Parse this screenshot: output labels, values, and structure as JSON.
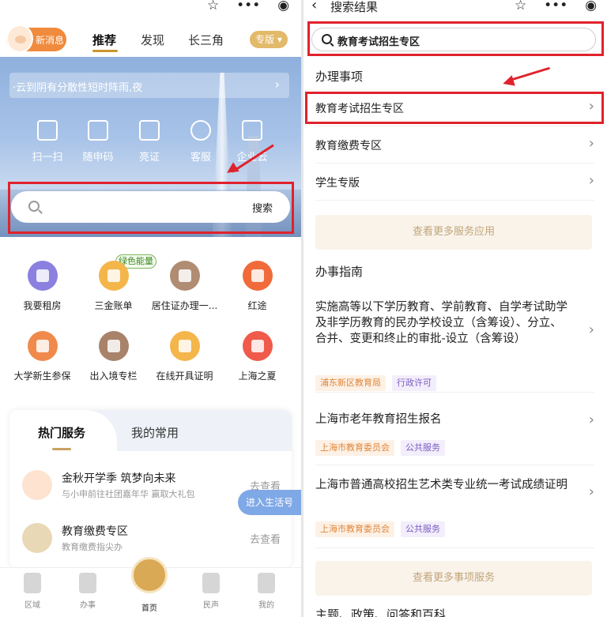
{
  "left": {
    "header": {
      "message_badge": "新消息",
      "tabs": [
        "推荐",
        "发现",
        "长三角"
      ],
      "edition": "专版"
    },
    "caps_icons": [
      "☆",
      "•••",
      "◉"
    ],
    "weather": {
      "text": "·云到阴有分散性短时阵雨,夜",
      "arrow": "›"
    },
    "quick_actions": [
      {
        "label": "扫一扫",
        "icon": "scan-icon"
      },
      {
        "label": "随申码",
        "icon": "qrcode-icon"
      },
      {
        "label": "亮证",
        "icon": "card-icon"
      },
      {
        "label": "客服",
        "icon": "headset-icon"
      },
      {
        "label": "企业云",
        "icon": "building-icon"
      }
    ],
    "search": {
      "button": "搜索"
    },
    "green_tag": "绿色能量",
    "services": [
      {
        "label": "我要租房",
        "color": "#8b7fe0",
        "icon": "house-icon"
      },
      {
        "label": "三金账单",
        "color": "#f4b54a",
        "icon": "yuan-icon"
      },
      {
        "label": "居住证办理一...",
        "color": "#b08c73",
        "icon": "id-card-icon"
      },
      {
        "label": "红途",
        "color": "#f06a3a",
        "icon": "star-icon"
      },
      {
        "label": "大学新生参保",
        "color": "#f08a4c",
        "icon": "edit-icon"
      },
      {
        "label": "出入境专栏",
        "color": "#a9826a",
        "icon": "plane-icon"
      },
      {
        "label": "在线开具证明",
        "color": "#f4b54a",
        "icon": "document-icon"
      },
      {
        "label": "上海之夏",
        "color": "#f05a4a",
        "icon": "cart-icon"
      }
    ],
    "hot_card": {
      "tab_active": "热门服务",
      "tab_other": "我的常用",
      "rows": [
        {
          "title": "金秋开学季 筑梦向未来",
          "subtitle": "与小申前往社团嘉年华 赢取大礼包",
          "action": "去查看",
          "avatar_color": "#fde3d0"
        },
        {
          "title": "教育缴费专区",
          "subtitle": "教育缴费指尖办",
          "action": "去查看",
          "avatar_color": "#e9d8b5"
        }
      ]
    },
    "float_button": "进入生活号",
    "nav": [
      "区域",
      "办事",
      "首页",
      "民声",
      "我的"
    ]
  },
  "right": {
    "top": {
      "back": "‹",
      "title": "搜索结果"
    },
    "caps_icons": [
      "☆",
      "•••",
      "◉"
    ],
    "search_value": "教育考试招生专区",
    "section1": "办理事项",
    "items": [
      "教育考试招生专区",
      "教育缴费专区",
      "学生专版"
    ],
    "more_services": "查看更多服务应用",
    "section2": "办事指南",
    "guides": [
      {
        "title": "实施高等以下学历教育、学前教育、自学考试助学及非学历教育的民办学校设立（含筹设）、分立、合并、变更和终止的审批-设立（含筹设）",
        "org": "浦东新区教育局",
        "type": "行政许可"
      },
      {
        "title": "上海市老年教育招生报名",
        "org": "上海市教育委员会",
        "type": "公共服务"
      },
      {
        "title": "上海市普通高校招生艺术类专业统一考试成绩证明",
        "org": "上海市教育委员会",
        "type": "公共服务"
      }
    ],
    "more_guides": "查看更多事项服务",
    "section3": "主题、政策、问答和百科"
  },
  "colors": {
    "highlight": "#e0222c",
    "accent_gold": "#c9952e",
    "tag_org": "#e0873a",
    "tag_type": "#7a5cc4"
  }
}
